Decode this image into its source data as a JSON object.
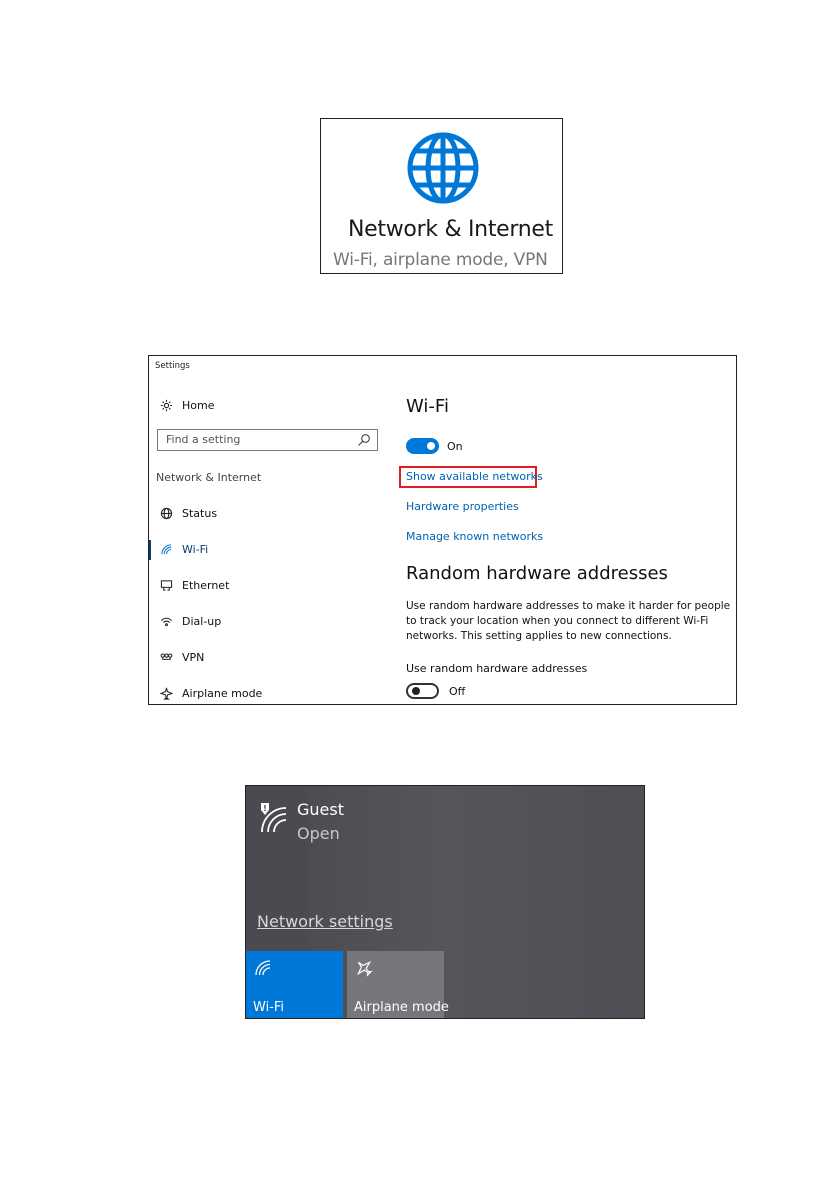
{
  "tile": {
    "title": "Network & Internet",
    "subtitle": "Wi-Fi, airplane mode, VPN",
    "icon": "globe-icon",
    "accent": "#0078d7"
  },
  "settings": {
    "window_title": "Settings",
    "home_label": "Home",
    "search_placeholder": "Find a setting",
    "section_label": "Network & Internet",
    "nav_items": [
      {
        "label": "Status",
        "icon": "globe-status-icon"
      },
      {
        "label": "Wi-Fi",
        "icon": "wifi-icon",
        "active": true
      },
      {
        "label": "Ethernet",
        "icon": "ethernet-icon"
      },
      {
        "label": "Dial-up",
        "icon": "dialup-icon"
      },
      {
        "label": "VPN",
        "icon": "vpn-icon"
      },
      {
        "label": "Airplane mode",
        "icon": "airplane-icon"
      }
    ],
    "content": {
      "heading": "Wi-Fi",
      "wifi_toggle_state": "On",
      "links": [
        "Show available networks",
        "Hardware properties",
        "Manage known networks"
      ],
      "rha_heading": "Random hardware addresses",
      "rha_body": "Use random hardware addresses to make it harder for people to track your location when you connect to different Wi-Fi networks. This setting applies to new connections.",
      "rha_sub": "Use random hardware addresses",
      "rha_toggle_state": "Off"
    },
    "highlight_color": "#e01b24",
    "link_color": "#0063b1"
  },
  "flyout": {
    "network_name": "Guest",
    "network_status": "Open",
    "network_settings_label": "Network settings",
    "tiles": [
      {
        "label": "Wi-Fi",
        "icon": "wifi-icon",
        "color": "#0078d7"
      },
      {
        "label": "Airplane mode",
        "icon": "airplane-icon",
        "color": "#76777b"
      }
    ]
  }
}
